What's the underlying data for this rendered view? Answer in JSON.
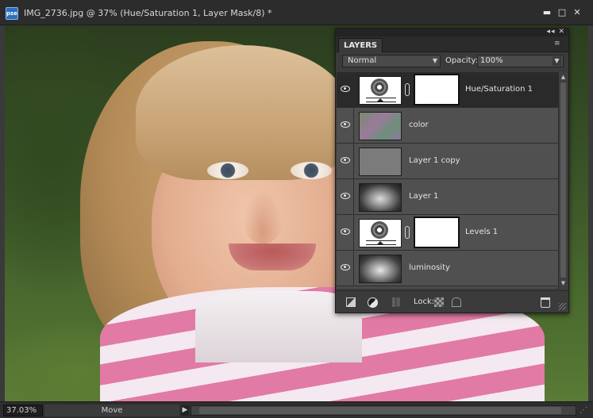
{
  "window": {
    "app_badge": "pse",
    "title": "IMG_2736.jpg @ 37% (Hue/Saturation 1, Layer Mask/8) *",
    "minimize": "▬",
    "maximize": "□",
    "close": "✕"
  },
  "layers_panel": {
    "tab_label": "LAYERS",
    "collapse": "◂◂",
    "close": "✕",
    "menu": "≡",
    "blend_mode": "Normal",
    "opacity_label": "Opacity:",
    "opacity_value": "100%",
    "layers": [
      {
        "name": "Hue/Saturation 1",
        "type": "adjustment",
        "mask": true,
        "visible": true,
        "selected": true
      },
      {
        "name": "color",
        "type": "pixel",
        "thumb": "color",
        "visible": true,
        "selected": false
      },
      {
        "name": "Layer 1 copy",
        "type": "pixel",
        "thumb": "gray",
        "visible": true,
        "selected": false
      },
      {
        "name": "Layer 1",
        "type": "pixel",
        "thumb": "photo",
        "visible": true,
        "selected": false
      },
      {
        "name": "Levels 1",
        "type": "adjustment",
        "mask": true,
        "visible": true,
        "selected": false
      },
      {
        "name": "luminosity",
        "type": "pixel",
        "thumb": "lum",
        "visible": true,
        "selected": false
      }
    ],
    "lock_label": "Lock:"
  },
  "status": {
    "zoom": "37.03%",
    "tool": "Move",
    "menu_arrow": "▶",
    "grip": "⋰"
  }
}
